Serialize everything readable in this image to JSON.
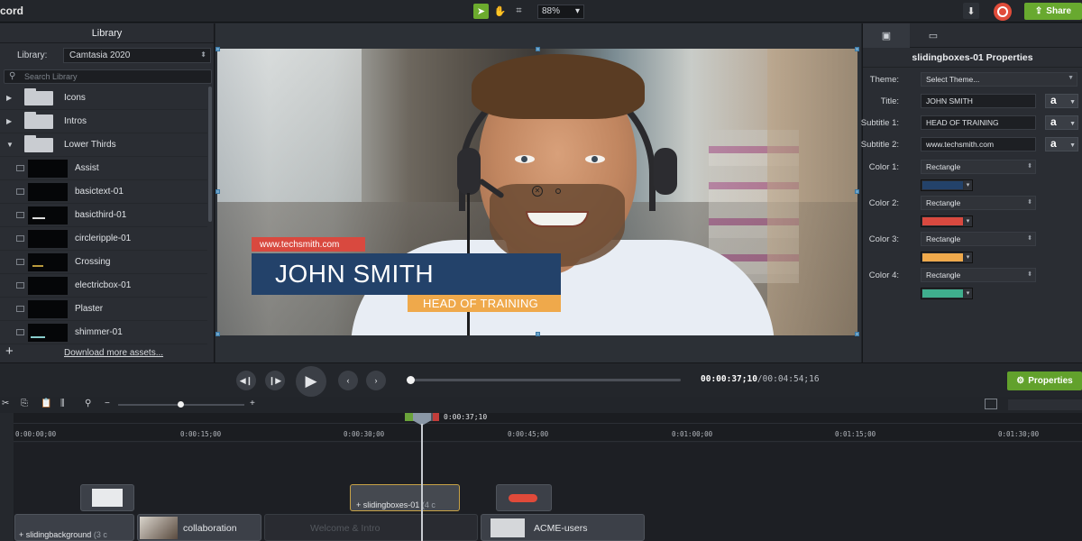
{
  "app": {
    "title": "cord"
  },
  "toolbar": {
    "zoom": "88%",
    "share_label": "Share"
  },
  "library": {
    "header": "Library",
    "select_label": "Library:",
    "select_value": "Camtasia 2020",
    "search_placeholder": "Search Library",
    "folders": [
      {
        "label": "Icons",
        "expanded": false
      },
      {
        "label": "Intros",
        "expanded": false
      },
      {
        "label": "Lower Thirds",
        "expanded": true
      }
    ],
    "assets": [
      "Assist",
      "basictext-01",
      "basicthird-01",
      "circleripple-01",
      "Crossing",
      "electricbox-01",
      "Plaster",
      "shimmer-01"
    ],
    "download_more": "Download more assets..."
  },
  "canvas": {
    "lower_third": {
      "url": "www.techsmith.com",
      "name": "JOHN SMITH",
      "subtitle": "HEAD OF TRAINING"
    },
    "colors": {
      "url_bar": "#d9493f",
      "name_bar": "#23426a",
      "subtitle_bar": "#efa94b"
    }
  },
  "properties": {
    "title": "slidingboxes-01 Properties",
    "theme_label": "Theme:",
    "theme_value": "Select Theme...",
    "title_label": "Title:",
    "title_value": "JOHN SMITH",
    "subtitle1_label": "Subtitle 1:",
    "subtitle1_value": "HEAD OF TRAINING",
    "subtitle2_label": "Subtitle 2:",
    "subtitle2_value": "www.techsmith.com",
    "font_glyph": "a",
    "colors": [
      {
        "label": "Color 1:",
        "shape": "Rectangle",
        "swatch": "#23426a"
      },
      {
        "label": "Color 2:",
        "shape": "Rectangle",
        "swatch": "#d9493f"
      },
      {
        "label": "Color 3:",
        "shape": "Rectangle",
        "swatch": "#efa94b"
      },
      {
        "label": "Color 4:",
        "shape": "Rectangle",
        "swatch": "#3fae8d"
      }
    ]
  },
  "playback": {
    "current_time": "00:00:37;10",
    "total_time": "00:04:54;16",
    "properties_button": "Properties",
    "progress": 0.13
  },
  "timeline": {
    "playhead_time": "0:00:37;10",
    "ruler_labels": [
      "0:00:00;00",
      "0:00:15;00",
      "0:00:30;00",
      "0:00:45;00",
      "0:01:00;00",
      "0:01:15;00",
      "0:01:30;00"
    ],
    "clips": {
      "sliding_boxes": {
        "name": "slidingboxes-01",
        "suffix": "(4 c"
      },
      "sliding_background": {
        "name": "slidingbackground",
        "suffix": "(3 c"
      },
      "collaboration": "collaboration",
      "welcome_ghost": "Welcome & Intro",
      "acme_users": "ACME-users"
    }
  }
}
